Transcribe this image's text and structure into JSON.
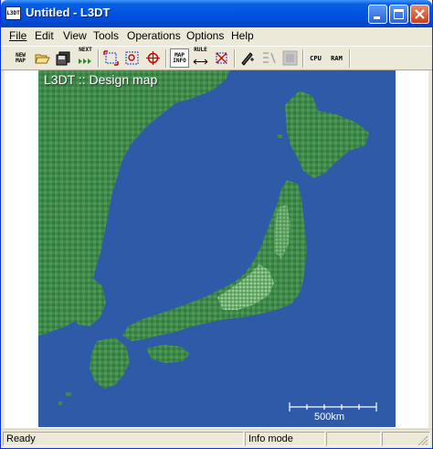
{
  "window": {
    "title": "Untitled - L3DT",
    "icon_text": "L3DT"
  },
  "menu": [
    "File",
    "Edit",
    "View",
    "Tools",
    "Operations",
    "Options",
    "Help"
  ],
  "toolbar": {
    "new_map": "NEW\nMAP",
    "next": "NEXT",
    "map_info": "MAP\nINFO",
    "rule": "RULE",
    "cpu": "CPU",
    "ram": "RAM"
  },
  "map": {
    "label": "L3DT :: Design map",
    "scale_label": "500km"
  },
  "status": {
    "left": "Ready",
    "mode": "Info mode"
  }
}
